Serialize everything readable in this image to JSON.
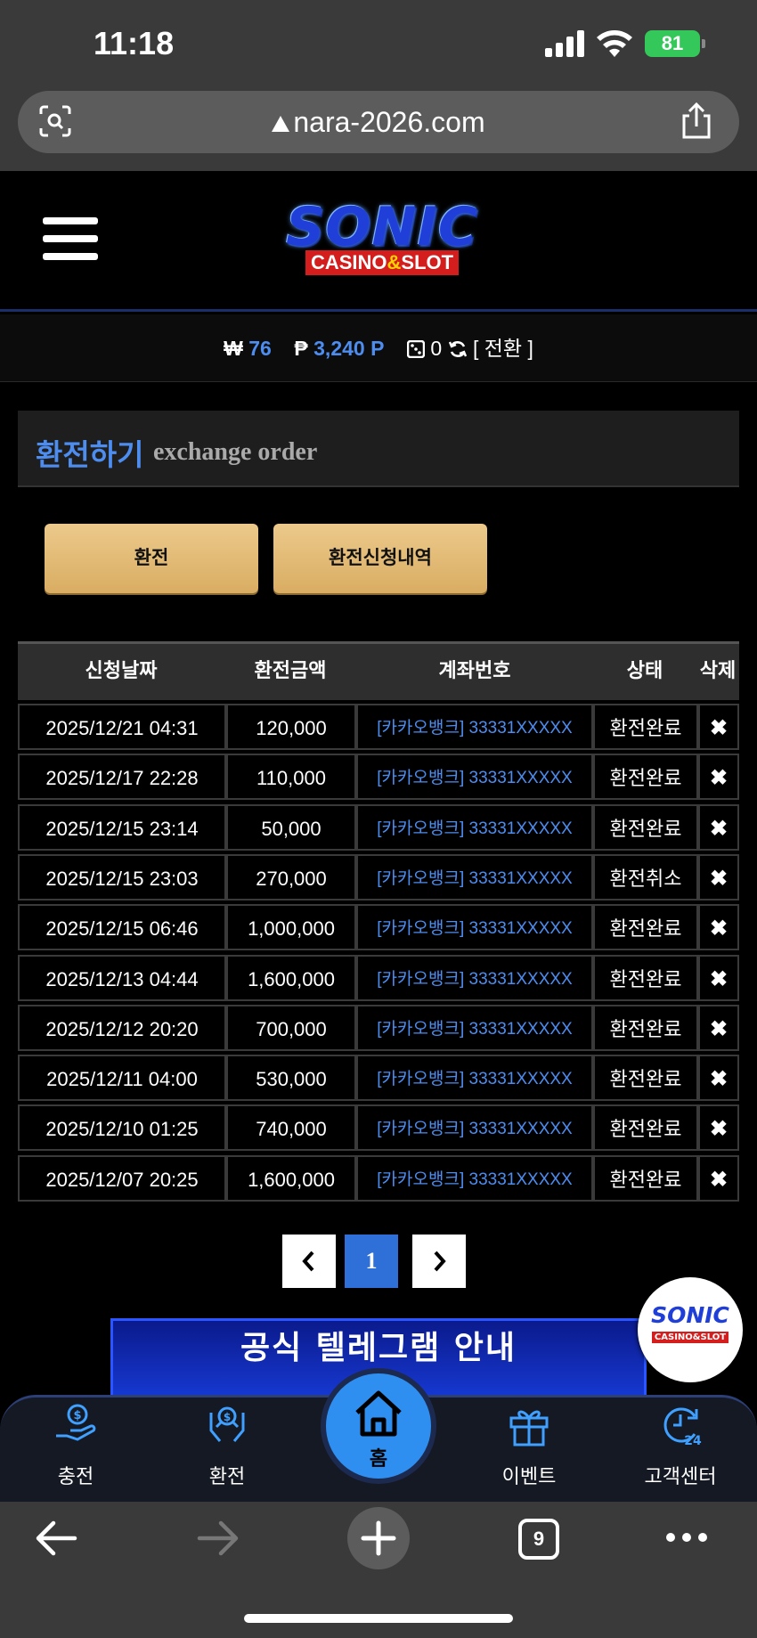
{
  "status_bar": {
    "time": "11:18",
    "battery": "81"
  },
  "browser": {
    "url": "nara-2026.com",
    "tabs_count": "9"
  },
  "brand": {
    "logo_main": "SONIC",
    "logo_sub_a": "CASINO",
    "logo_sub_amp": "&",
    "logo_sub_b": "SLOT"
  },
  "balance": {
    "won_symbol": "₩",
    "won_value": "76",
    "point_symbol": "₱",
    "point_value": "3,240 P",
    "casino_value": "0",
    "convert_label": "[ 전환 ]"
  },
  "page": {
    "title_ko": "환전하기",
    "title_en": "exchange order"
  },
  "buttons": {
    "exchange": "환전",
    "history": "환전신청내역"
  },
  "table": {
    "headers": [
      "신청날짜",
      "환전금액",
      "계좌번호",
      "상태",
      "삭제"
    ],
    "rows": [
      {
        "date": "2025/12/21 04:31",
        "amount": "120,000",
        "account": "[카카오뱅크] 33331XXXXX",
        "status": "환전완료",
        "delete": "✖"
      },
      {
        "date": "2025/12/17 22:28",
        "amount": "110,000",
        "account": "[카카오뱅크] 33331XXXXX",
        "status": "환전완료",
        "delete": "✖"
      },
      {
        "date": "2025/12/15 23:14",
        "amount": "50,000",
        "account": "[카카오뱅크] 33331XXXXX",
        "status": "환전완료",
        "delete": "✖"
      },
      {
        "date": "2025/12/15 23:03",
        "amount": "270,000",
        "account": "[카카오뱅크] 33331XXXXX",
        "status": "환전취소",
        "delete": "✖"
      },
      {
        "date": "2025/12/15 06:46",
        "amount": "1,000,000",
        "account": "[카카오뱅크] 33331XXXXX",
        "status": "환전완료",
        "delete": "✖"
      },
      {
        "date": "2025/12/13 04:44",
        "amount": "1,600,000",
        "account": "[카카오뱅크] 33331XXXXX",
        "status": "환전완료",
        "delete": "✖"
      },
      {
        "date": "2025/12/12 20:20",
        "amount": "700,000",
        "account": "[카카오뱅크] 33331XXXXX",
        "status": "환전완료",
        "delete": "✖"
      },
      {
        "date": "2025/12/11 04:00",
        "amount": "530,000",
        "account": "[카카오뱅크] 33331XXXXX",
        "status": "환전완료",
        "delete": "✖"
      },
      {
        "date": "2025/12/10 01:25",
        "amount": "740,000",
        "account": "[카카오뱅크] 33331XXXXX",
        "status": "환전완료",
        "delete": "✖"
      },
      {
        "date": "2025/12/07 20:25",
        "amount": "1,600,000",
        "account": "[카카오뱅크] 33331XXXXX",
        "status": "환전완료",
        "delete": "✖"
      }
    ]
  },
  "pagination": {
    "current": "1"
  },
  "banner": {
    "text": "공식 텔레그램 안내"
  },
  "fab": {
    "main": "SONIC",
    "sub": "CASINO&SLOT"
  },
  "bottom_nav": {
    "deposit": "충전",
    "exchange": "환전",
    "home": "홈",
    "event": "이벤트",
    "support": "고객센터"
  },
  "colors": {
    "accent": "#4d8df0",
    "button_gold": "#e3bb77",
    "home_blue": "#2e8ff0"
  }
}
